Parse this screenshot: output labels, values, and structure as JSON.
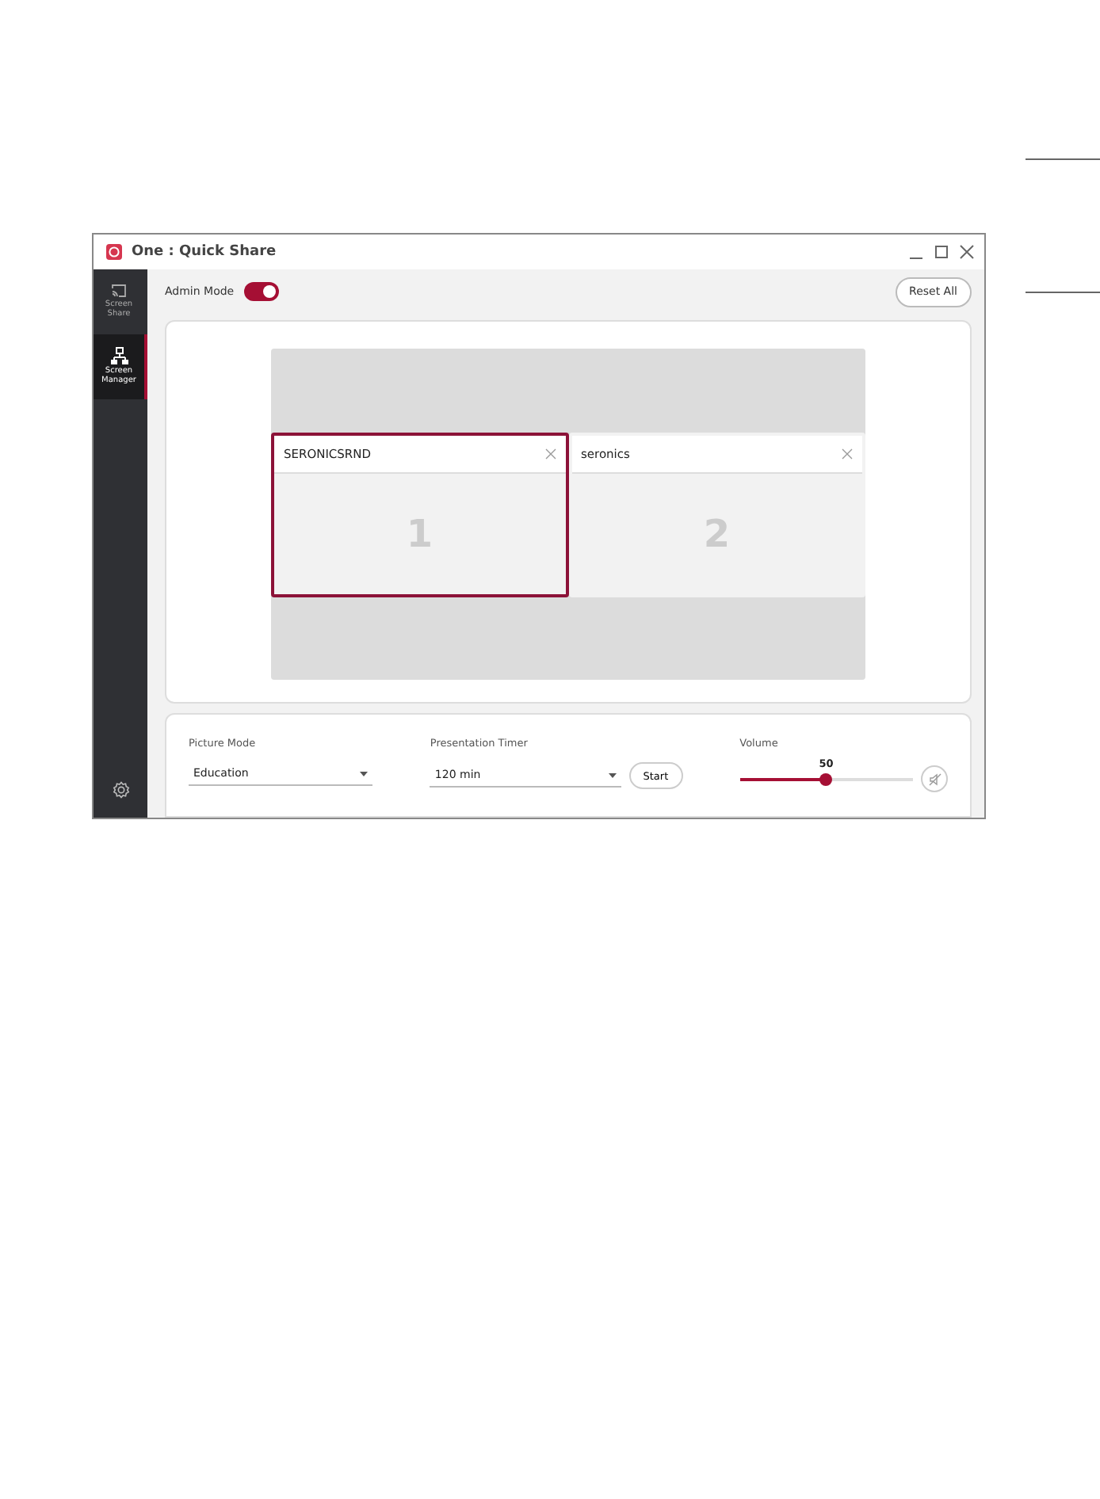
{
  "window": {
    "title": "One : Quick Share"
  },
  "sidebar": {
    "items": [
      {
        "kind": "cast",
        "label": "Screen Share",
        "selected": false
      },
      {
        "kind": "network",
        "label": "Screen Manager",
        "selected": true
      }
    ]
  },
  "admin_mode": {
    "label": "Admin Mode",
    "on": true
  },
  "reset_button": "Reset All",
  "screens": [
    {
      "name": "SERONICSRND",
      "number": "1",
      "selected": true
    },
    {
      "name": "seronics",
      "number": "2",
      "selected": false
    }
  ],
  "controls": {
    "picture_mode": {
      "label": "Picture Mode",
      "value": "Education"
    },
    "timer": {
      "label": "Presentation Timer",
      "value": "120 min",
      "button": "Start"
    },
    "volume": {
      "label": "Volume",
      "reading": "50",
      "level": 0.5,
      "muted": false
    }
  }
}
